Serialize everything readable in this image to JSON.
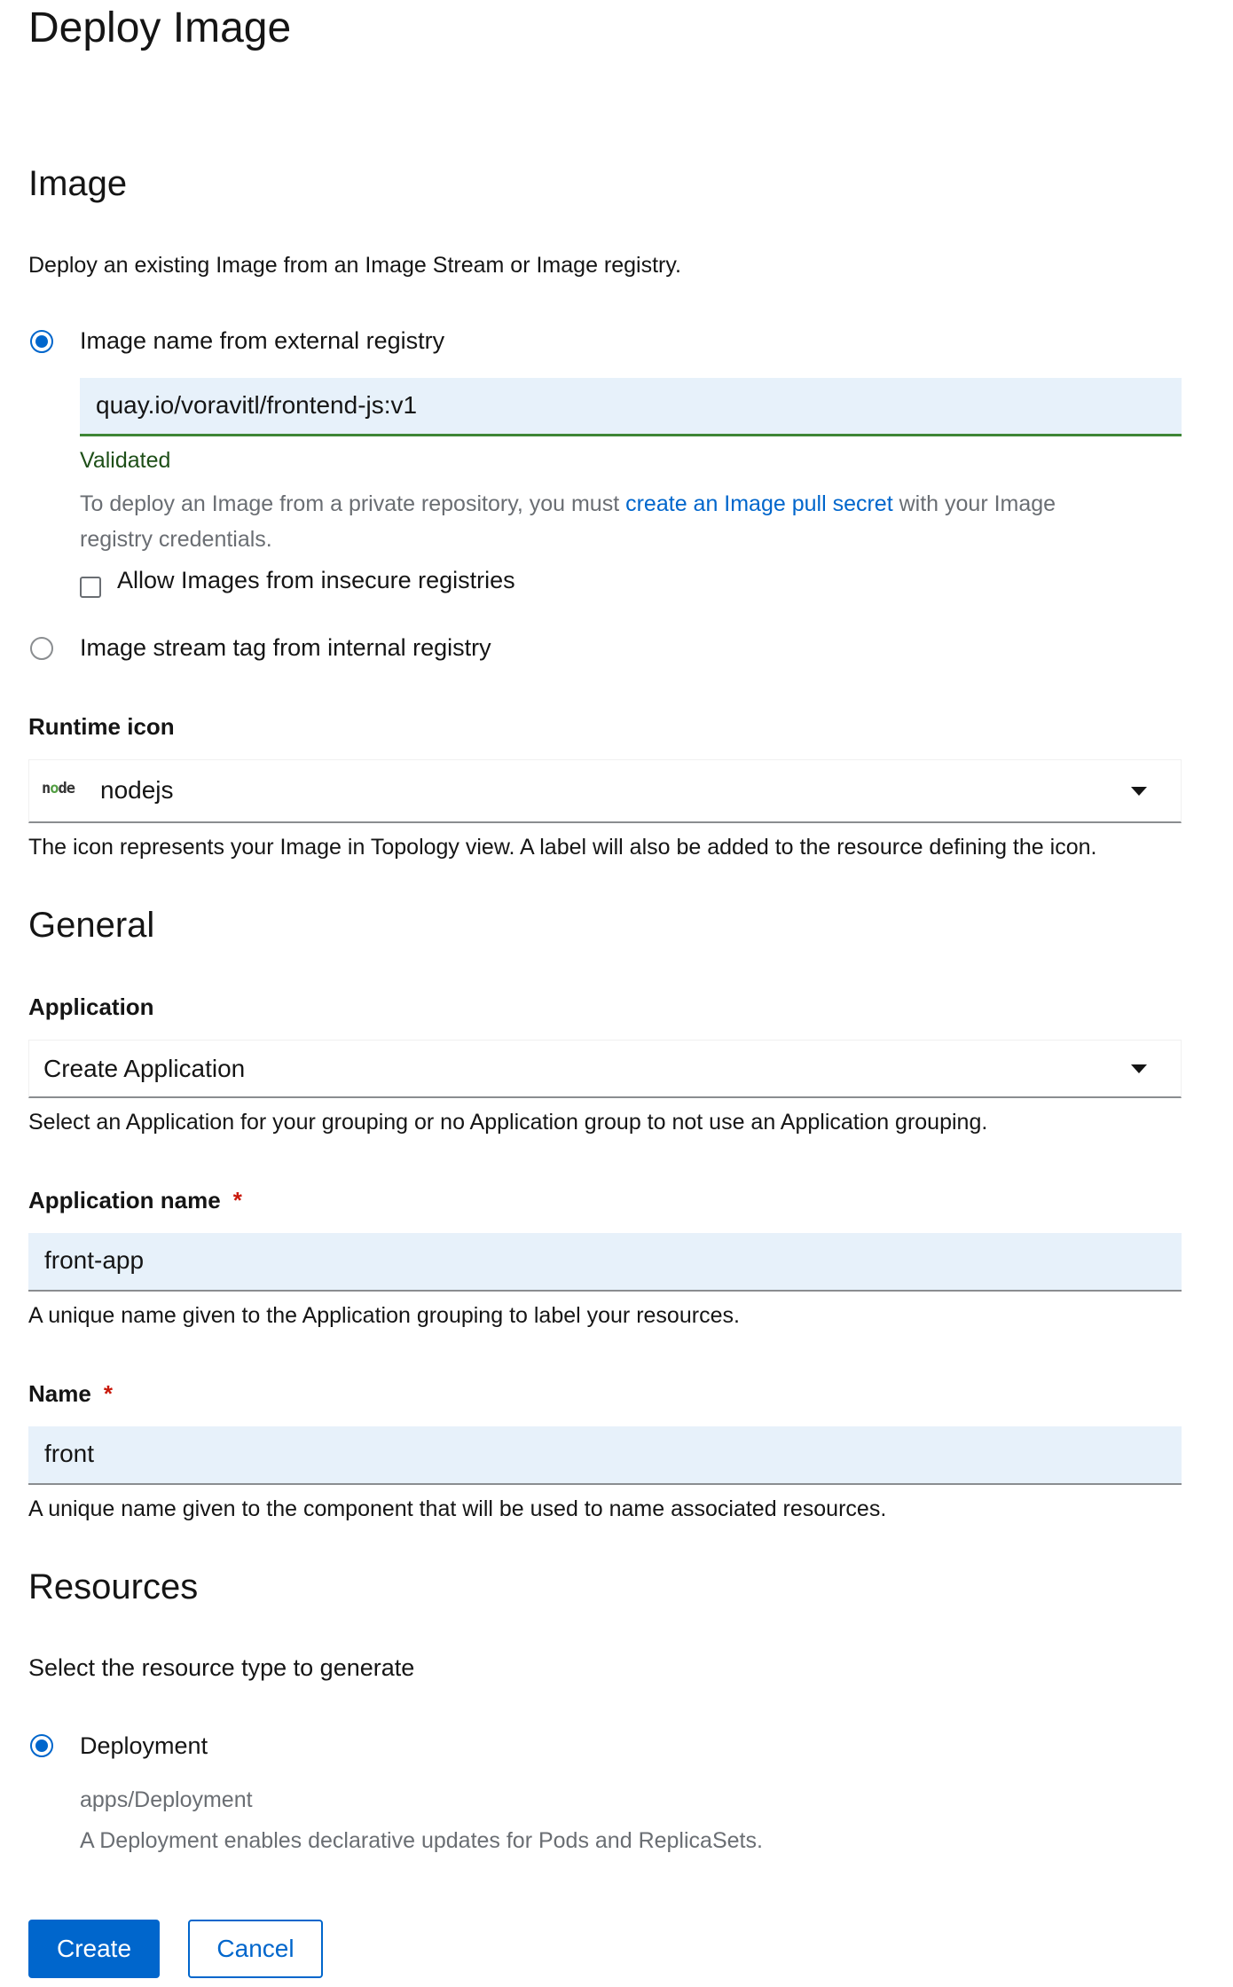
{
  "page": {
    "title": "Deploy Image"
  },
  "image_section": {
    "heading": "Image",
    "description": "Deploy an existing Image from an Image Stream or Image registry.",
    "external_option_label": "Image name from external registry",
    "external_option_selected": true,
    "image_name_value": "quay.io/voravitl/frontend-js:v1",
    "validation_status": "Validated",
    "help_prefix": "To deploy an Image from a private repository, you must ",
    "help_link": "create an Image pull secret",
    "help_suffix_line1": " with your Image",
    "help_suffix_line2": "registry credentials.",
    "insecure_checkbox_label": "Allow Images from insecure registries",
    "insecure_checkbox_checked": false,
    "internal_option_label": "Image stream tag from internal registry",
    "internal_option_selected": false
  },
  "runtime_icon": {
    "label": "Runtime icon",
    "icon_name": "nodejs-logo-icon",
    "icon_text": "node",
    "selected_value": "nodejs",
    "helper": "The icon represents your Image in Topology view. A label will also be added to the resource defining the icon."
  },
  "general_section": {
    "heading": "General",
    "application_label": "Application",
    "application_selected": "Create Application",
    "application_helper": "Select an Application for your grouping or no Application group to not use an Application grouping.",
    "application_name_label": "Application name",
    "application_name_value": "front-app",
    "application_name_helper": "A unique name given to the Application grouping to label your resources.",
    "name_label": "Name",
    "name_value": "front",
    "name_helper": "A unique name given to the component that will be used to name associated resources.",
    "required_marker": "*"
  },
  "resources_section": {
    "heading": "Resources",
    "description": "Select the resource type to generate",
    "deployment_label": "Deployment",
    "deployment_selected": true,
    "deployment_api": "apps/Deployment",
    "deployment_description": "A Deployment enables declarative updates for Pods and ReplicaSets."
  },
  "actions": {
    "create_label": "Create",
    "cancel_label": "Cancel"
  },
  "colors": {
    "primary": "#0066cc",
    "validated": "#3e8635",
    "required": "#c9190b",
    "input_bg": "#e7f1fa"
  }
}
